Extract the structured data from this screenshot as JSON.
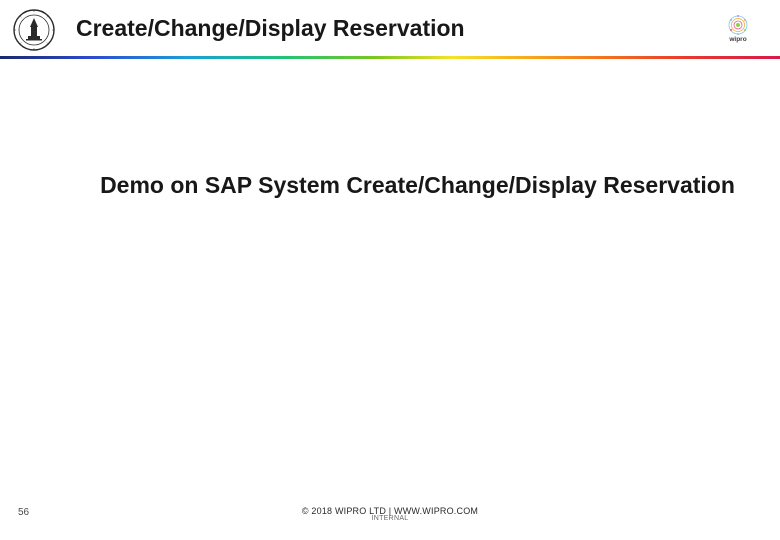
{
  "header": {
    "title": "Create/Change/Display Reservation"
  },
  "body": {
    "heading": "Demo on SAP System Create/Change/Display Reservation"
  },
  "footer": {
    "page_number": "56",
    "copyright": "© 2018 WIPRO LTD | WWW.WIPRO.COM",
    "subtext": "INTERNAL"
  },
  "icons": {
    "seal": "seal-icon",
    "brand": "wipro-icon"
  }
}
